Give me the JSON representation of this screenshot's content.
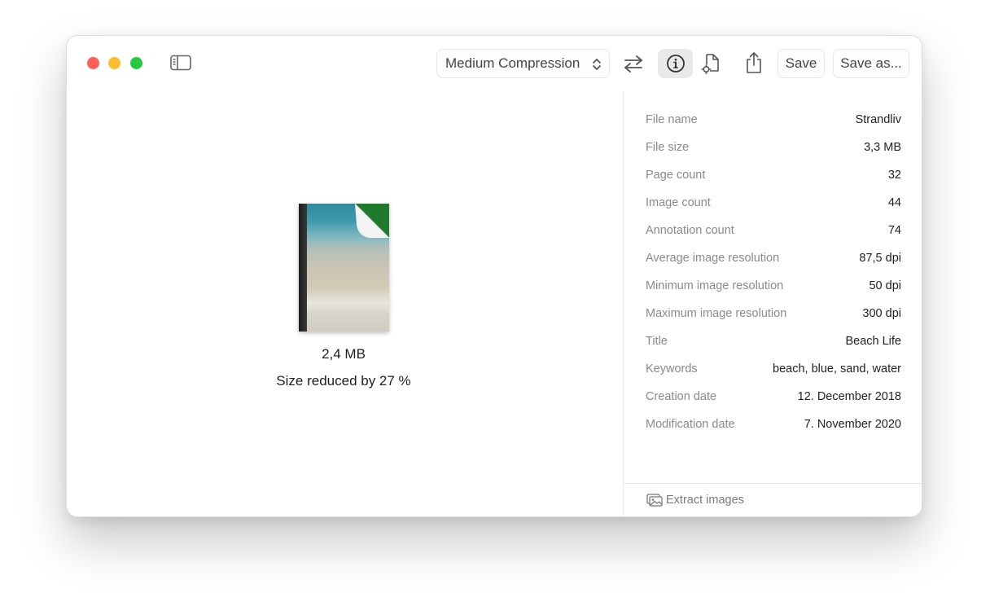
{
  "toolbar": {
    "compression_label": "Medium Compression",
    "save_label": "Save",
    "save_as_label": "Save as..."
  },
  "preview": {
    "new_size": "2,4 MB",
    "reduction": "Size reduced by 27 %"
  },
  "info": {
    "rows": [
      {
        "label": "File name",
        "value": "Strandliv"
      },
      {
        "label": "File size",
        "value": "3,3 MB"
      },
      {
        "label": "Page count",
        "value": "32"
      },
      {
        "label": "Image count",
        "value": "44"
      },
      {
        "label": "Annotation count",
        "value": "74"
      },
      {
        "label": "Average image resolution",
        "value": "87,5 dpi"
      },
      {
        "label": "Minimum image resolution",
        "value": "50 dpi"
      },
      {
        "label": "Maximum image resolution",
        "value": "300 dpi"
      },
      {
        "label": "Title",
        "value": "Beach Life"
      },
      {
        "label": "Keywords",
        "value": "beach, blue, sand, water"
      },
      {
        "label": "Creation date",
        "value": "12. December 2018"
      },
      {
        "label": "Modification date",
        "value": "7. November 2020"
      }
    ],
    "extract_label": "Extract images"
  },
  "icons": {
    "sidebar": "sidebar-icon",
    "swap": "arrows-swap-icon",
    "info": "info-circle-icon",
    "doc_settings": "document-gear-icon",
    "share": "share-icon",
    "extract": "photo-stack-icon"
  },
  "colors": {
    "close": "#ff5f57",
    "minimize": "#febc2e",
    "maximize": "#28c840",
    "corner_fold": "#1f7a2e"
  }
}
